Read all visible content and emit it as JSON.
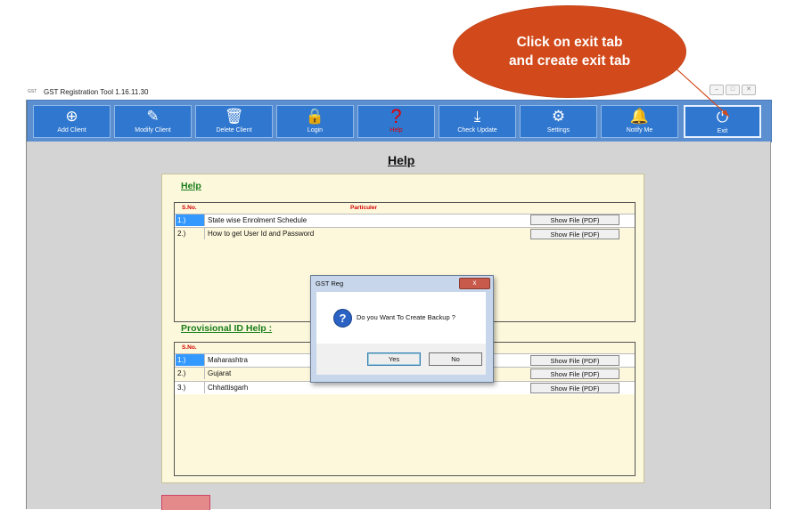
{
  "callout": {
    "line1": "Click on exit tab",
    "line2": "and create exit tab"
  },
  "window": {
    "app_icon": "GST",
    "title": "GST Registration Tool  1.16.11.30",
    "ctl_minimize": "–",
    "ctl_maximize": "□",
    "ctl_close": "✕"
  },
  "toolbar": {
    "items": [
      {
        "label": "Add Client",
        "icon": "plus-circle-icon"
      },
      {
        "label": "Modify Client",
        "icon": "edit-icon"
      },
      {
        "label": "Delete Client",
        "icon": "trash-icon"
      },
      {
        "label": "Login",
        "icon": "lock-icon"
      },
      {
        "label": "Help",
        "icon": "question-icon"
      },
      {
        "label": "Check Update",
        "icon": "download-icon"
      },
      {
        "label": "Settings",
        "icon": "gear-icon"
      },
      {
        "label": "Notify Me",
        "icon": "bell-icon"
      },
      {
        "label": "Exit",
        "icon": "power-icon"
      }
    ],
    "icons": [
      "⊕",
      "✎",
      "🗑",
      "🔒",
      "?",
      "⤓",
      "⚙",
      "🔔",
      "⏻"
    ]
  },
  "page": {
    "title": "Help"
  },
  "help": {
    "section_title": "Help",
    "col_sno": "S.No.",
    "col_particular": "Particuler",
    "rows": [
      {
        "sno": "1.)",
        "text": "State wise Enrolment Schedule",
        "button": "Show File (PDF)"
      },
      {
        "sno": "2.)",
        "text": "How to get User Id and Password",
        "button": "Show File (PDF)"
      }
    ]
  },
  "provisional": {
    "section_title": "Provisional ID Help :",
    "col_sno": "S.No.",
    "rows": [
      {
        "sno": "1.)",
        "text": "Maharashtra",
        "button": "Show File (PDF)"
      },
      {
        "sno": "2.)",
        "text": "Gujarat",
        "button": "Show File (PDF)"
      },
      {
        "sno": "3.)",
        "text": "Chhattisgarh",
        "button": "Show File (PDF)"
      }
    ]
  },
  "dialog": {
    "title": "GST Reg",
    "close": "x",
    "icon": "?",
    "message": "Do you Want To Create Backup ?",
    "yes": "Yes",
    "no": "No"
  },
  "colors": {
    "callout": "#d24a1b",
    "toolbar": "#2f77cf",
    "panel": "#fbf8dc",
    "section": "#1a7d1a"
  }
}
